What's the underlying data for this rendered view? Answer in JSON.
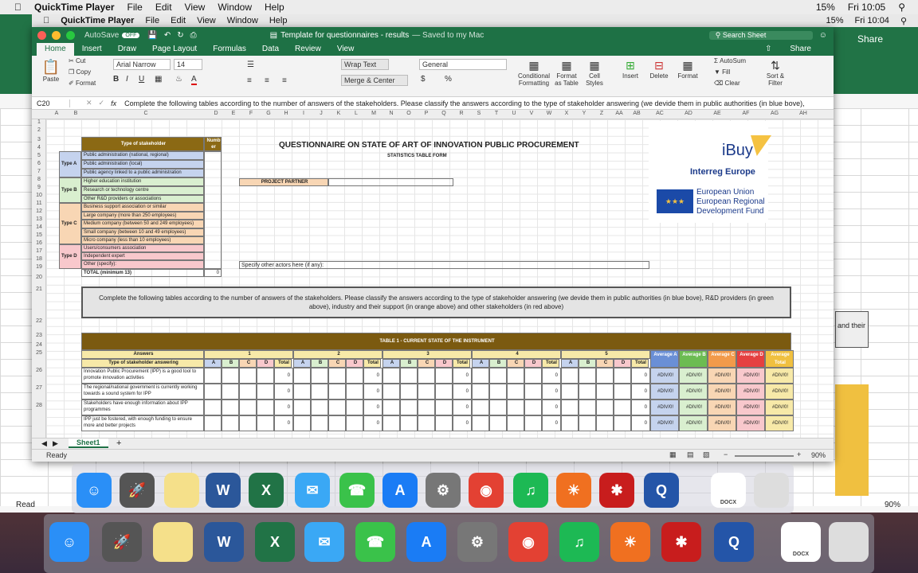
{
  "outer_menubar": {
    "app": "QuickTime Player",
    "items": [
      "File",
      "Edit",
      "View",
      "Window",
      "Help"
    ],
    "battery": "15%",
    "time": "Fri 10:05"
  },
  "inner_menubar": {
    "app": "QuickTime Player",
    "items": [
      "File",
      "Edit",
      "View",
      "Window",
      "Help"
    ],
    "battery": "15%",
    "time": "Fri 10:04"
  },
  "window": {
    "autosave": "AutoSave",
    "autosave_state": "OFF",
    "title": "Template for questionnaires - results",
    "saved": "— Saved to my Mac",
    "search_placeholder": "Search Sheet"
  },
  "tabs": [
    "Home",
    "Insert",
    "Draw",
    "Page Layout",
    "Formulas",
    "Data",
    "Review",
    "View"
  ],
  "share": "Share",
  "ribbon": {
    "paste": "Paste",
    "cut": "Cut",
    "copy": "Copy",
    "format": "Format",
    "font": "Arial Narrow",
    "size": "14",
    "wrap": "Wrap Text",
    "merge": "Merge & Center",
    "numfmt": "General",
    "cond": "Conditional Formatting",
    "fmt_table": "Format as Table",
    "cell_styles": "Cell Styles",
    "insert": "Insert",
    "delete": "Delete",
    "formatc": "Format",
    "autosum": "AutoSum",
    "fill": "Fill",
    "clear": "Clear",
    "sort": "Sort & Filter"
  },
  "formula": {
    "ref": "C20",
    "fx": "fx",
    "text": "Complete the following tables according to the number of answers of the stakeholders. Please classify the answers according to the type of stakeholder answering (we devide them in public authorities (in blue bove), R&D"
  },
  "columns": [
    "A",
    "B",
    "C",
    "D",
    "E",
    "F",
    "G",
    "H",
    "I",
    "J",
    "K",
    "L",
    "M",
    "N",
    "O",
    "P",
    "Q",
    "R",
    "S",
    "T",
    "U",
    "V",
    "W",
    "X",
    "Y",
    "Z",
    "AA",
    "AB",
    "AC",
    "AD",
    "AE",
    "AF",
    "AG",
    "AH"
  ],
  "rows": [
    "1",
    "2",
    "3",
    "4",
    "5",
    "6",
    "7",
    "8",
    "9",
    "10",
    "11",
    "12",
    "13",
    "14",
    "15",
    "16",
    "17",
    "18",
    "19",
    "20",
    "21",
    "22",
    "23",
    "24",
    "25",
    "26",
    "27",
    "28"
  ],
  "sheet": {
    "type_header": "Type of stakeholder",
    "numb_header": "Numb er",
    "typeA": "Type A",
    "typeB": "Type B",
    "typeC": "Type C",
    "typeD": "Type D",
    "a1": "Public administration (national, regional)",
    "a2": "Public administration (local)",
    "a3": "Public agency linked to a public administration",
    "b1": "Higher education institution",
    "b2": "Research or technology centre",
    "b3": "Other R&D providers or associations",
    "c1": "Business support association or similar",
    "c2": "Large company (more than 250 employees)",
    "c3": "Medium company (between 50 and 249 employees)",
    "c4": "Small company (between 10 and 49 employees)",
    "c5": "Micro company (less than 10 employees)",
    "d1": "Users/consumers association",
    "d2": "Independent expert",
    "d3": "Other (specify):",
    "total": "TOTAL (minimum 13)",
    "total_val": "0",
    "main_title": "QUESTIONNAIRE ON STATE OF ART OF INNOVATION PUBLIC PROCUREMENT",
    "sub_title": "STATISTICS TABLE FORM",
    "project_partner": "PROJECT PARTNER",
    "specify": "Specify other actors here (if any):",
    "logo_ibuy": "iBuy",
    "logo_interreg": "Interreg Europe",
    "eu1": "European Union",
    "eu2": "European Regional",
    "eu3": "Development Fund",
    "instructions": "Complete the following tables according to the number of answers of the stakeholders. Please classify the answers according to the type of stakeholder answering (we devide them in public authorities (in blue bove), R&D providers (in green above), industry and their support (in orange above) and other stakeholders (in red above)",
    "table1_title": "TABLE 1 - CURRENT STATE OF THE INSTRUMENT",
    "answers": "Answers",
    "type_answering": "Type of stakeholder answering",
    "answer_groups": [
      "1",
      "2",
      "3",
      "4",
      "5"
    ],
    "sub_cols": [
      "A",
      "B",
      "C",
      "D",
      "Total"
    ],
    "avg_headers": [
      "Average A",
      "Average B",
      "Average C",
      "Average D",
      "Average Total"
    ],
    "questions": [
      "Innovation Public Procurement (IPP) is a good tool to promote innovation activities",
      "The regional/national government is currently working towards a sound system for IPP",
      "Stakeholders have enough information about IPP programmes",
      "IPP just be fostered, with enough funding to ensure more and better projects"
    ],
    "div": "#DIV/0!",
    "zero": "0"
  },
  "sheet_tab": "Sheet1",
  "status": "Ready",
  "zoom": "90%",
  "outer_zoom": "90%",
  "outer_ready": "Read",
  "dock_labels": {
    "docx": "DOCX"
  }
}
